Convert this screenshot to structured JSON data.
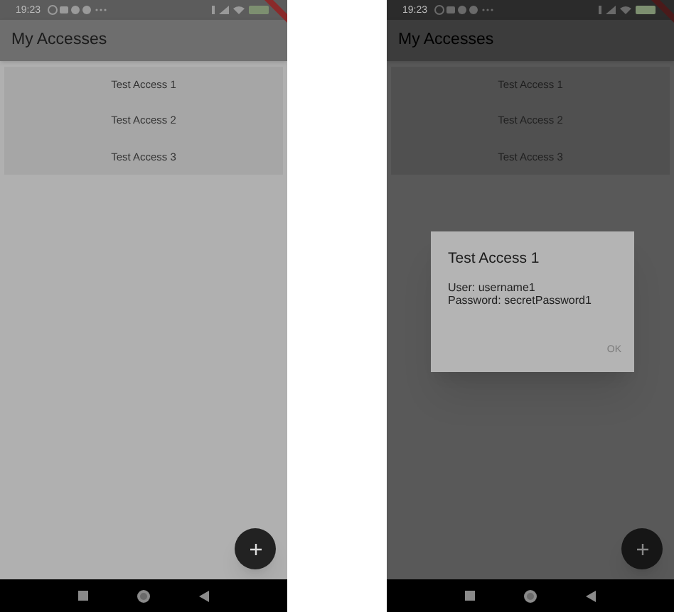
{
  "screens": [
    {
      "status_bar": {
        "time": "19:23"
      },
      "app_bar": {
        "title": "My Accesses"
      },
      "list": [
        {
          "label": "Test Access 1"
        },
        {
          "label": "Test Access 2"
        },
        {
          "label": "Test Access 3"
        }
      ],
      "dimmed": false
    },
    {
      "status_bar": {
        "time": "19:23"
      },
      "app_bar": {
        "title": "My Accesses"
      },
      "list": [
        {
          "label": "Test Access 1"
        },
        {
          "label": "Test Access 2"
        },
        {
          "label": "Test Access 3"
        }
      ],
      "dimmed": true,
      "dialog": {
        "title": "Test Access 1",
        "lines": [
          "User: username1",
          "Password: secretPassword1"
        ],
        "button": "OK"
      }
    }
  ]
}
